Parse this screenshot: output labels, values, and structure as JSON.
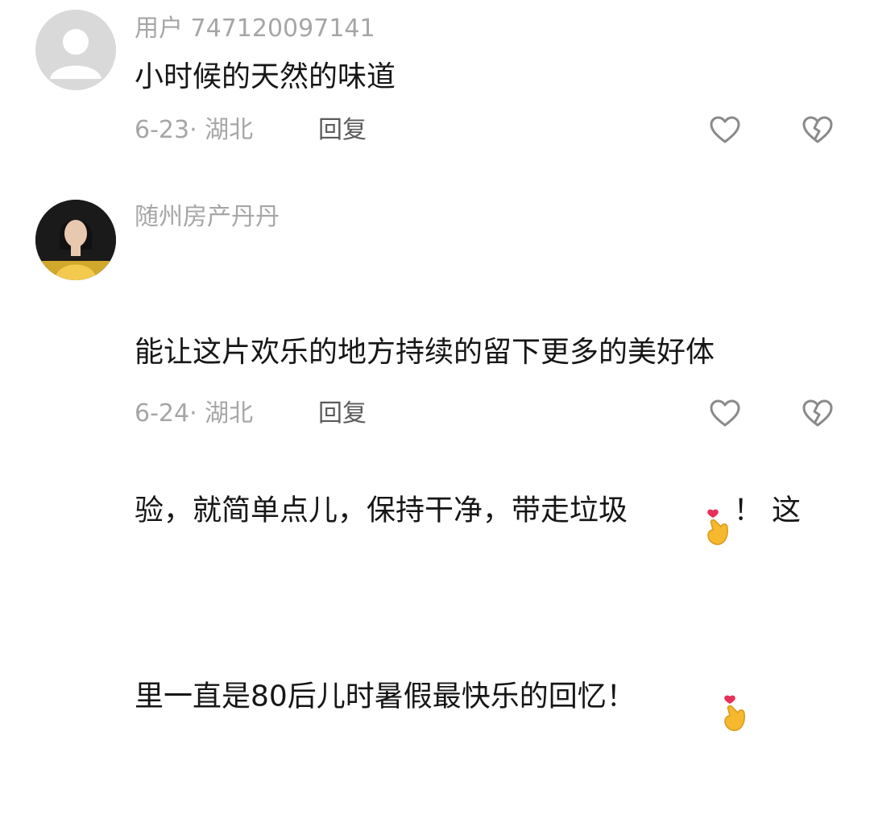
{
  "comments": [
    {
      "username": "用户 747120097141",
      "avatar_icon": "default-user-avatar",
      "content": "小时候的天然的味道",
      "date": "6-23",
      "location": "湖北",
      "reply_label": "回复"
    },
    {
      "username": "随州房产丹丹",
      "avatar_icon": "user-photo-avatar",
      "content_lines": [
        "能让这片欢乐的地方持续的留下更多的美好体",
        "验，就简单点儿，保持干净，带走垃圾",
        "！ 这",
        "里一直是80后儿时暑假最快乐的回忆！"
      ],
      "date": "6-24",
      "location": "湖北",
      "reply_label": "回复"
    }
  ],
  "icons": {
    "like": "heart-outline-icon",
    "dislike": "broken-heart-icon",
    "emoji": "finger-heart-emoji"
  },
  "colors": {
    "secondary_text": "#a6a6a6",
    "primary_text": "#161616",
    "reply_text": "#5b5b5b",
    "icon_stroke": "#8a8a8a",
    "emoji_heart": "#e8305a",
    "emoji_hand": "#f5b82e"
  }
}
